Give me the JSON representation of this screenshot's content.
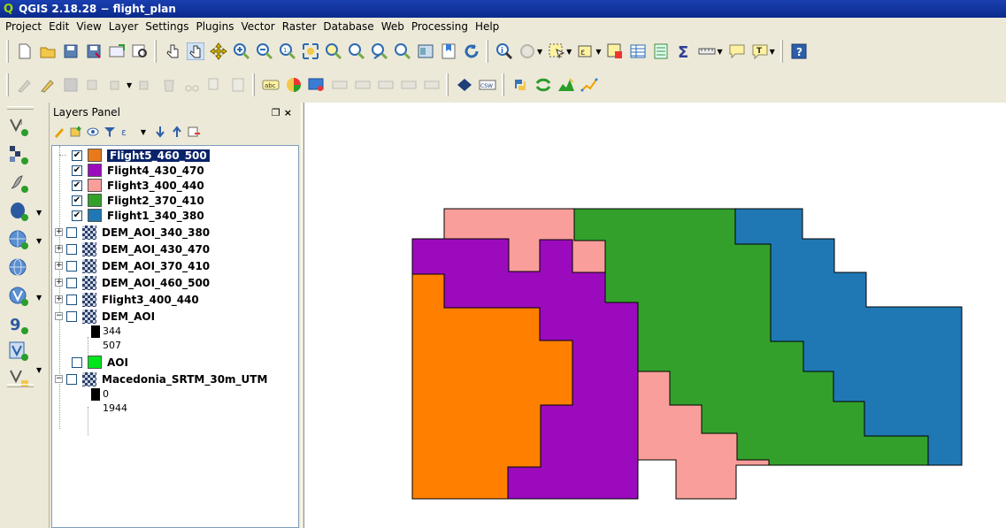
{
  "window": {
    "title": "QGIS 2.18.28 − flight_plan"
  },
  "menubar": {
    "items": [
      "Project",
      "Edit",
      "View",
      "Layer",
      "Settings",
      "Plugins",
      "Vector",
      "Raster",
      "Database",
      "Web",
      "Processing",
      "Help"
    ]
  },
  "layers_panel": {
    "title": "Layers Panel",
    "float_close": "Α ×",
    "layers": [
      {
        "name": "Flight5_460_500",
        "checked": true,
        "type": "vector",
        "color": "#e87a1c",
        "selected": true
      },
      {
        "name": "Flight4_430_470",
        "checked": true,
        "type": "vector",
        "color": "#9b0bbd"
      },
      {
        "name": "Flight3_400_440",
        "checked": true,
        "type": "vector",
        "color": "#fa9e9b"
      },
      {
        "name": "Flight2_370_410",
        "checked": true,
        "type": "vector",
        "color": "#33a02c"
      },
      {
        "name": "Flight1_340_380",
        "checked": true,
        "type": "vector",
        "color": "#1f78b4"
      },
      {
        "name": "DEM_AOI_340_380",
        "checked": false,
        "type": "raster"
      },
      {
        "name": "DEM_AOI_430_470",
        "checked": false,
        "type": "raster"
      },
      {
        "name": "DEM_AOI_370_410",
        "checked": false,
        "type": "raster"
      },
      {
        "name": "DEM_AOI_460_500",
        "checked": false,
        "type": "raster"
      },
      {
        "name": "Flight3_400_440",
        "checked": false,
        "type": "raster"
      },
      {
        "name": "DEM_AOI",
        "checked": false,
        "type": "raster",
        "legend": [
          "344",
          "507"
        ]
      },
      {
        "name": "AOI",
        "checked": false,
        "type": "vector",
        "color": "#00e61a"
      },
      {
        "name": "Macedonia_SRTM_30m_UTM",
        "checked": false,
        "type": "raster",
        "legend": [
          "0",
          "1944"
        ]
      }
    ]
  },
  "map": {
    "colors": {
      "flight1": "#1f78b4",
      "flight2": "#33a02c",
      "flight3": "#fa9e9b",
      "flight4": "#9b0bbd",
      "flight5": "#ff7f00"
    }
  },
  "icons": {
    "toolbar1": [
      "new-project-icon",
      "open-project-icon",
      "save-project-icon",
      "save-as-icon",
      "new-print-composer-icon",
      "composer-manager-icon",
      "touch-zoom-icon",
      "pan-icon",
      "pan-to-selection-icon",
      "zoom-in-icon",
      "zoom-out-icon",
      "zoom-native-icon",
      "zoom-full-icon",
      "zoom-to-selection-icon",
      "zoom-to-layer-icon",
      "zoom-last-icon",
      "zoom-next-icon",
      "new-map-view-icon",
      "new-bookmark-icon",
      "refresh-icon",
      "identify-icon",
      "run-action-icon",
      "select-features-icon",
      "select-by-expression-icon",
      "deselect-icon",
      "attribute-table-icon",
      "field-calculator-icon",
      "statistics-icon",
      "measure-icon",
      "map-tips-icon",
      "text-annotation-icon",
      "help-icon"
    ],
    "toolbar2": [
      "current-edits-icon",
      "toggle-editing-icon",
      "save-edits-icon",
      "add-feature-icon",
      "move-feature-icon",
      "node-tool-icon",
      "delete-selected-icon",
      "cut-features-icon",
      "copy-features-icon",
      "paste-features-icon",
      "label-tool-icon",
      "diagram-tool-icon",
      "pin-labels-icon",
      "show-hide-labels-icon",
      "move-label-icon",
      "rotate-label-icon",
      "change-label-icon",
      "metasearch-icon",
      "csw-icon",
      "python-console-icon",
      "plugin-reloader-icon",
      "profile-tool-icon",
      "flight-line-icon"
    ]
  }
}
